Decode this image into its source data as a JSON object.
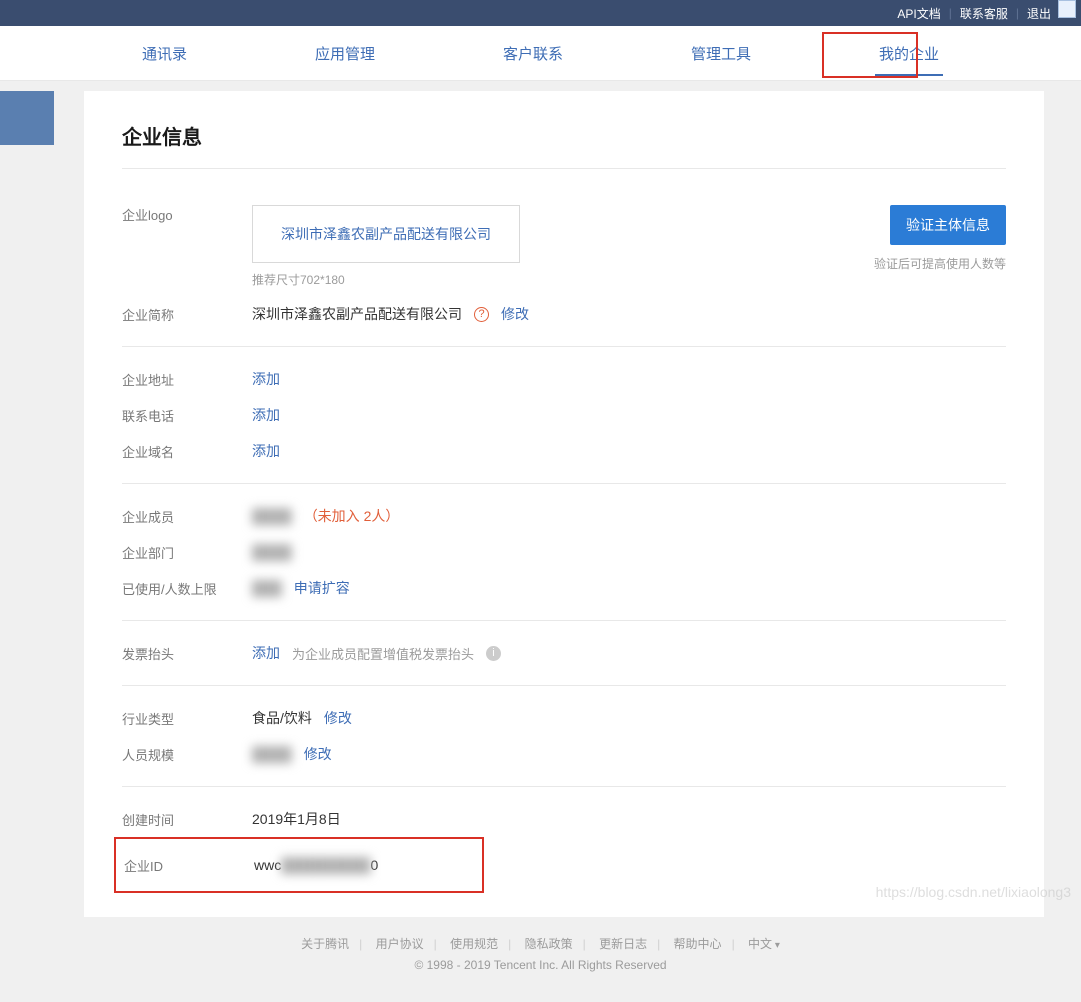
{
  "topbar": {
    "api_link": "API文档",
    "contact_link": "联系客服",
    "logout_link": "退出"
  },
  "nav": {
    "contacts": "通讯录",
    "apps": "应用管理",
    "customer": "客户联系",
    "tools": "管理工具",
    "my_company": "我的企业"
  },
  "page": {
    "title": "企业信息"
  },
  "logo_section": {
    "label": "企业logo",
    "company_name": "深圳市泽鑫农副产品配送有限公司",
    "hint": "推荐尺寸702*180",
    "verify_button": "验证主体信息",
    "verify_hint": "验证后可提高使用人数等"
  },
  "short_name": {
    "label": "企业简称",
    "value": "深圳市泽鑫农副产品配送有限公司",
    "modify": "修改"
  },
  "address": {
    "label": "企业地址",
    "action": "添加"
  },
  "phone": {
    "label": "联系电话",
    "action": "添加"
  },
  "domain": {
    "label": "企业域名",
    "action": "添加"
  },
  "members": {
    "label": "企业成员",
    "blur_text": "████",
    "pending": "（未加入 2人）"
  },
  "departments": {
    "label": "企业部门",
    "blur_text": "████"
  },
  "used_limit": {
    "label": "已使用/人数上限",
    "blur_text": "███",
    "action": "申请扩容"
  },
  "invoice": {
    "label": "发票抬头",
    "action": "添加",
    "hint": "为企业成员配置增值税发票抬头"
  },
  "industry": {
    "label": "行业类型",
    "value": "食品/饮料",
    "modify": "修改"
  },
  "scale": {
    "label": "人员规模",
    "blur_text": "████",
    "modify": "修改"
  },
  "created": {
    "label": "创建时间",
    "value": "2019年1月8日"
  },
  "company_id": {
    "label": "企业ID",
    "prefix": "wwc",
    "blur_text": "█████████",
    "suffix": "0"
  },
  "footer": {
    "links": {
      "about": "关于腾讯",
      "agreement": "用户协议",
      "usage": "使用规范",
      "privacy": "隐私政策",
      "changelog": "更新日志",
      "help": "帮助中心",
      "lang": "中文"
    },
    "copyright": "© 1998 - 2019 Tencent Inc. All Rights Reserved"
  },
  "watermark": "https://blog.csdn.net/lixiaolong3"
}
